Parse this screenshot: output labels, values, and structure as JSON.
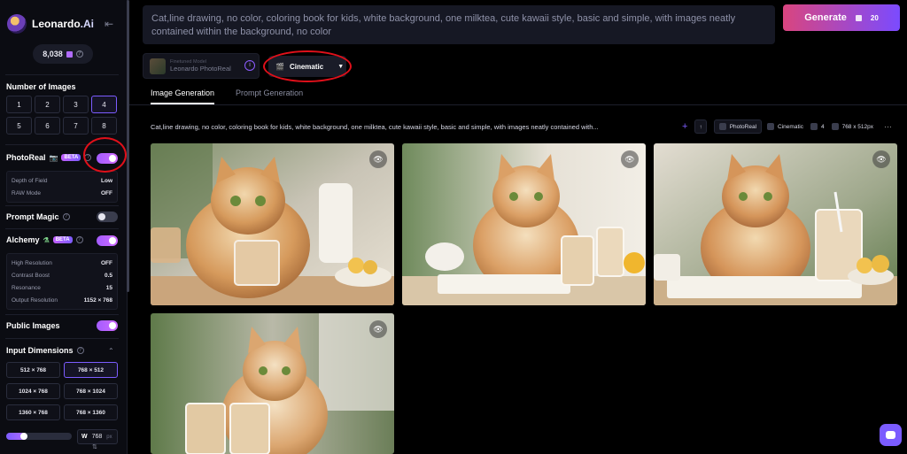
{
  "sidebar": {
    "brand_name": "Leonardo",
    "brand_suffix": ".Ai",
    "collapse_icon": "collapse-arrow-icon",
    "credits": "8,038",
    "number_of_images": {
      "title": "Number of Images",
      "options": [
        "1",
        "2",
        "3",
        "4",
        "5",
        "6",
        "7",
        "8"
      ],
      "selected": "4"
    },
    "photoreal": {
      "label": "PhotoReal",
      "badge": "BETA",
      "enabled": true,
      "settings": [
        {
          "label": "Depth of Field",
          "value": "Low"
        },
        {
          "label": "RAW Mode",
          "value": "OFF"
        }
      ]
    },
    "prompt_magic": {
      "label": "Prompt Magic",
      "enabled": false
    },
    "alchemy": {
      "label": "Alchemy",
      "badge": "BETA",
      "enabled": true,
      "settings": [
        {
          "label": "High Resolution",
          "value": "OFF"
        },
        {
          "label": "Contrast Boost",
          "value": "0.5"
        },
        {
          "label": "Resonance",
          "value": "15"
        },
        {
          "label": "Output Resolution",
          "value": "1152 × 768"
        }
      ]
    },
    "public_images": {
      "label": "Public Images",
      "enabled": true
    },
    "input_dimensions": {
      "title": "Input Dimensions",
      "options": [
        "512 × 768",
        "768 × 512",
        "1024 × 768",
        "768 × 1024",
        "1360 × 768",
        "768 × 1360"
      ],
      "selected": "768 × 512"
    },
    "width": {
      "label": "W",
      "value": "768",
      "unit": "px"
    }
  },
  "main": {
    "prompt_text": "Cat,line drawing, no color, coloring book for kids, white background, one milktea, cute kawaii style, basic and simple, with images neatly contained within the background, no color",
    "generate": {
      "label": "Generate",
      "cost": "20"
    },
    "model": {
      "small_label": "Finetuned Model",
      "name": "Leonardo PhotoReal"
    },
    "style": {
      "label": "Cinematic"
    },
    "tabs": [
      {
        "label": "Image Generation",
        "active": true
      },
      {
        "label": "Prompt Generation",
        "active": false
      }
    ],
    "generation": {
      "prompt": "Cat,line drawing, no color, coloring book for kids, white background, one milktea, cute kawaii style, basic and simple, with images neatly contained with...",
      "chips": [
        {
          "label": "PhotoReal",
          "icon": "model-icon"
        },
        {
          "label": "Cinematic",
          "icon": "style-icon"
        },
        {
          "label": "4",
          "icon": "images-icon"
        },
        {
          "label": "768 x 512px",
          "icon": "dimensions-icon"
        }
      ],
      "images": [
        "cat-with-milktea-1",
        "cat-with-milktea-2",
        "cat-with-milktea-3",
        "cat-with-milktea-4"
      ]
    }
  },
  "colors": {
    "accent": "#7c5cff",
    "annotation": "#e0101a",
    "generate_start": "#d9457f",
    "generate_end": "#7b4bff"
  }
}
